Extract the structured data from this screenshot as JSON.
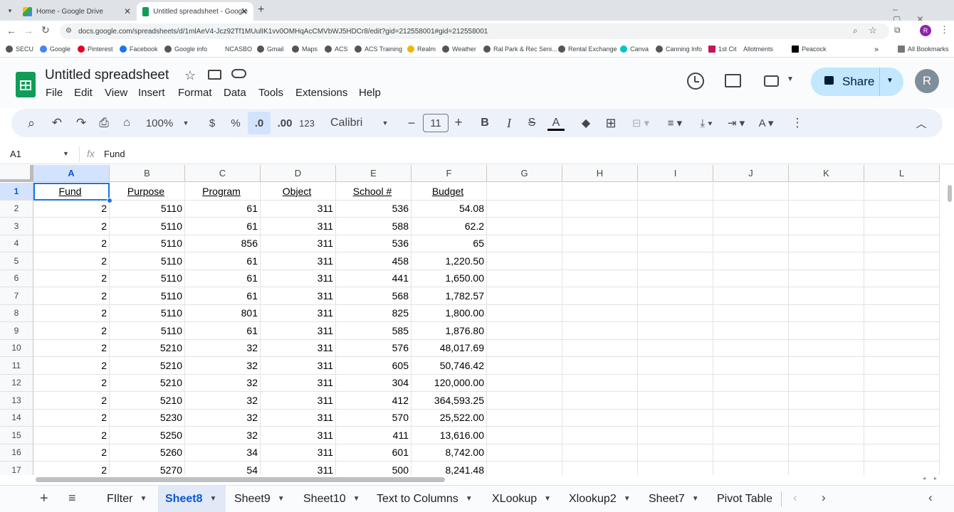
{
  "browser": {
    "tabs": [
      {
        "title": "Home - Google Drive",
        "active": false
      },
      {
        "title": "Untitled spreadsheet - Google",
        "active": true
      }
    ],
    "url": "docs.google.com/spreadsheets/d/1mlAeV4-Jcz92Tf1MUulIK1vv0OMHqAcCMVbWJ5HDCr8/edit?gid=212558001#gid=212558001",
    "bookmarks": [
      "SECU",
      "Google",
      "Pinterest",
      "Facebook",
      "Google info",
      "NCASBO",
      "Gmail",
      "Maps",
      "ACS",
      "ACS Training",
      "Realm",
      "Weather",
      "Ral Park & Rec Seni...",
      "Rental Exchange",
      "Canva",
      "Canning Info",
      "1st Cit",
      "Allotments",
      "Peacock"
    ],
    "all_bookmarks": "All Bookmarks",
    "profile_initial": "R"
  },
  "app": {
    "title": "Untitled spreadsheet",
    "menus": [
      "File",
      "Edit",
      "View",
      "Insert",
      "Format",
      "Data",
      "Tools",
      "Extensions",
      "Help"
    ],
    "share_label": "Share",
    "avatar_initial": "R"
  },
  "toolbar": {
    "zoom": "100%",
    "currency": "$",
    "percent": "%",
    "dec_decrease": ".0",
    "dec_increase": ".00",
    "number_format": "123",
    "font": "Calibri",
    "font_size": "11",
    "bold": "B",
    "italic": "I",
    "strike": "S",
    "text_color": "A"
  },
  "formula_bar": {
    "cell_ref": "A1",
    "fx": "fx",
    "content": "Fund"
  },
  "grid": {
    "columns": [
      "A",
      "B",
      "C",
      "D",
      "E",
      "F",
      "G",
      "H",
      "I",
      "J",
      "K",
      "L"
    ],
    "row_numbers": [
      "1",
      "2",
      "3",
      "4",
      "5",
      "6",
      "7",
      "8",
      "9",
      "10",
      "11",
      "12",
      "13",
      "14",
      "15",
      "16",
      "17"
    ],
    "headers": [
      "Fund",
      "Purpose",
      "Program",
      "Object",
      "School #",
      "Budget"
    ],
    "rows": [
      [
        "2",
        "5110",
        "61",
        "311",
        "536",
        "54.08"
      ],
      [
        "2",
        "5110",
        "61",
        "311",
        "588",
        "62.2"
      ],
      [
        "2",
        "5110",
        "856",
        "311",
        "536",
        "65"
      ],
      [
        "2",
        "5110",
        "61",
        "311",
        "458",
        "1,220.50"
      ],
      [
        "2",
        "5110",
        "61",
        "311",
        "441",
        "1,650.00"
      ],
      [
        "2",
        "5110",
        "61",
        "311",
        "568",
        "1,782.57"
      ],
      [
        "2",
        "5110",
        "801",
        "311",
        "825",
        "1,800.00"
      ],
      [
        "2",
        "5110",
        "61",
        "311",
        "585",
        "1,876.80"
      ],
      [
        "2",
        "5210",
        "32",
        "311",
        "576",
        "48,017.69"
      ],
      [
        "2",
        "5210",
        "32",
        "311",
        "605",
        "50,746.42"
      ],
      [
        "2",
        "5210",
        "32",
        "311",
        "304",
        "120,000.00"
      ],
      [
        "2",
        "5210",
        "32",
        "311",
        "412",
        "364,593.25"
      ],
      [
        "2",
        "5230",
        "32",
        "311",
        "570",
        "25,522.00"
      ],
      [
        "2",
        "5250",
        "32",
        "311",
        "411",
        "13,616.00"
      ],
      [
        "2",
        "5260",
        "34",
        "311",
        "601",
        "8,742.00"
      ],
      [
        "2",
        "5270",
        "54",
        "311",
        "500",
        "8,241.48"
      ]
    ]
  },
  "sheets": {
    "tabs": [
      "FIlter",
      "Sheet8",
      "Sheet9",
      "Sheet10",
      "Text to Columns",
      "XLookup",
      "Xlookup2",
      "Sheet7",
      "Pivot Table"
    ],
    "active": "Sheet8"
  },
  "colors": {
    "accent": "#0b57d0",
    "share_bg": "#c2e7ff",
    "selection": "#1a73e8",
    "sheets_green": "#0f9d58"
  }
}
